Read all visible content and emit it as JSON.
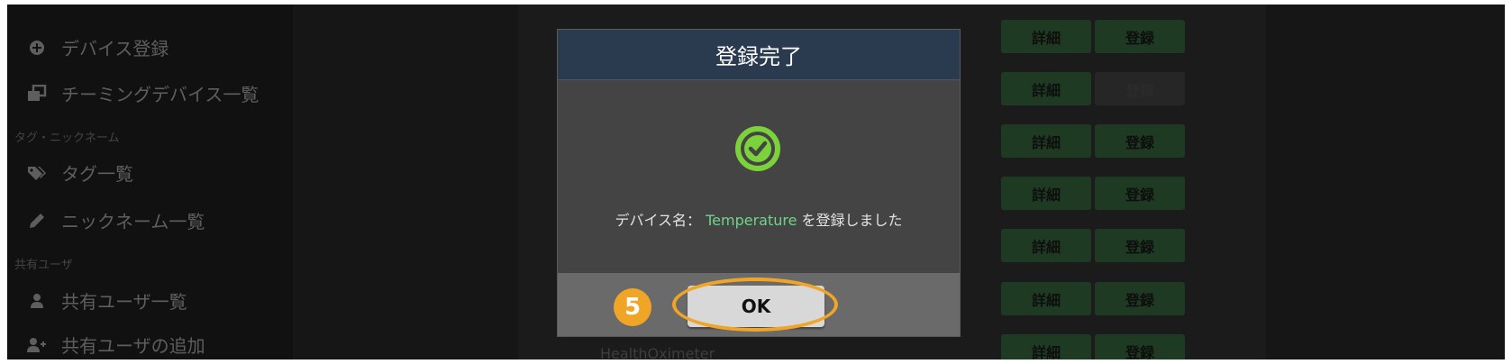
{
  "sidebar": {
    "items": [
      {
        "label": "デバイス登録",
        "icon": "plus-circle-icon"
      },
      {
        "label": "チーミングデバイス一覧",
        "icon": "clone-icon"
      },
      {
        "label": "タグ一覧",
        "icon": "tags-icon"
      },
      {
        "label": "ニックネーム一覧",
        "icon": "pencil-icon"
      },
      {
        "label": "共有ユーザ一覧",
        "icon": "user-icon"
      },
      {
        "label": "共有ユーザの追加",
        "icon": "user-plus-icon"
      }
    ],
    "sections": [
      "タグ・ニックネーム",
      "共有ユーザ"
    ]
  },
  "table": {
    "detail_label": "詳細",
    "register_label": "登録",
    "visible_row_text": "HealthOximeter",
    "register_disabled_rows": [
      1
    ]
  },
  "modal": {
    "title": "登録完了",
    "icon": "check-circle-icon",
    "message_prefix": "デバイス名：",
    "device_name": "Temperature",
    "message_suffix": "を登録しました",
    "ok_label": "OK"
  },
  "annotation": {
    "step_number": "5",
    "highlight_color": "#f0a527"
  },
  "colors": {
    "success": "#7cd23a",
    "device_name": "#6fd48a",
    "modal_header": "#2a3a4f"
  }
}
